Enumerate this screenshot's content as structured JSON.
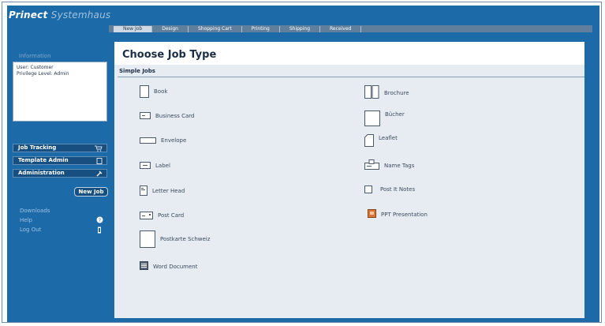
{
  "brand": {
    "name": "Prinect",
    "product": "Systemhaus"
  },
  "tabs": [
    {
      "label": "New Job",
      "active": true
    },
    {
      "label": "Design",
      "active": false
    },
    {
      "label": "Shopping Cart",
      "active": false
    },
    {
      "label": "Printing",
      "active": false
    },
    {
      "label": "Shipping",
      "active": false
    },
    {
      "label": "Received",
      "active": false
    }
  ],
  "sidebar": {
    "section_label": "Information",
    "user_line": "User: Customer",
    "privilege_line": "Privilege Level: Admin",
    "nav": [
      {
        "label": "Job Tracking",
        "icon": "cart-icon"
      },
      {
        "label": "Template Admin",
        "icon": "template-icon"
      },
      {
        "label": "Administration",
        "icon": "tool-icon"
      }
    ],
    "new_job_label": "New Job",
    "links": [
      {
        "label": "Downloads",
        "icon": ""
      },
      {
        "label": "Help",
        "icon": "help-icon"
      },
      {
        "label": "Log Out",
        "icon": "logout-icon"
      }
    ]
  },
  "main": {
    "title": "Choose Job Type",
    "section": "Simple Jobs",
    "jobs_left": [
      {
        "label": "Book",
        "icon": "book-icon"
      },
      {
        "label": "Business Card",
        "icon": "business-card-icon"
      },
      {
        "label": "Envelope",
        "icon": "envelope-icon"
      },
      {
        "label": "Label",
        "icon": "label-icon"
      },
      {
        "label": "Letter Head",
        "icon": "letterhead-icon"
      },
      {
        "label": "Post Card",
        "icon": "postcard-icon"
      },
      {
        "label": "Postkarte Schweiz",
        "icon": "postkarte-icon"
      },
      {
        "label": "Word Document",
        "icon": "word-document-icon"
      }
    ],
    "jobs_right": [
      {
        "label": "Brochure",
        "icon": "brochure-icon"
      },
      {
        "label": "Bücher",
        "icon": "buecher-icon"
      },
      {
        "label": "Leaflet",
        "icon": "leaflet-icon"
      },
      {
        "label": "Name Tags",
        "icon": "name-tags-icon"
      },
      {
        "label": "Post It Notes",
        "icon": "post-it-icon"
      },
      {
        "label": "PPT Presentation",
        "icon": "ppt-icon"
      }
    ]
  }
}
